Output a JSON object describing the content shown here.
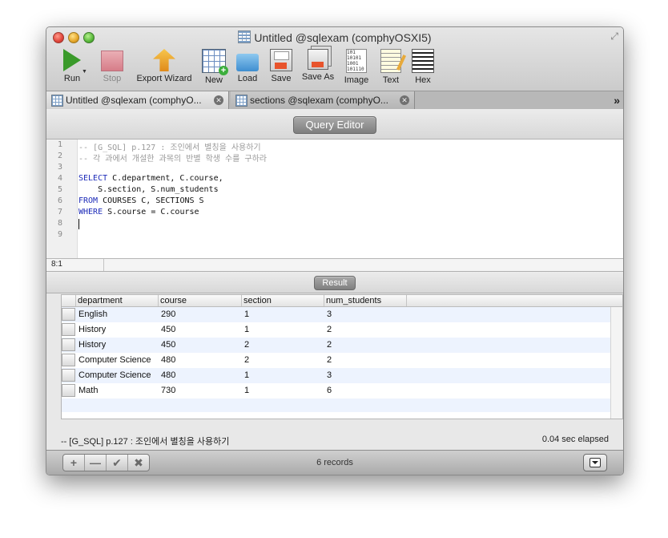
{
  "window": {
    "title": "Untitled @sqlexam (comphyOSXI5)"
  },
  "toolbar": [
    {
      "label": "Run",
      "icon": "play-icon",
      "enabled": true
    },
    {
      "label": "Stop",
      "icon": "stop-icon",
      "enabled": false
    },
    {
      "label": "Export Wizard",
      "icon": "export-wizard-icon",
      "enabled": true
    },
    {
      "label": "New",
      "icon": "new-table-icon",
      "enabled": true
    },
    {
      "label": "Load",
      "icon": "folder-icon",
      "enabled": true
    },
    {
      "label": "Save",
      "icon": "floppy-icon",
      "enabled": true
    },
    {
      "label": "Save As",
      "icon": "floppy-stack-icon",
      "enabled": true
    },
    {
      "label": "Image",
      "icon": "binary-image-icon",
      "enabled": true
    },
    {
      "label": "Text",
      "icon": "text-document-icon",
      "enabled": true
    },
    {
      "label": "Hex",
      "icon": "hex-grid-icon",
      "enabled": true
    }
  ],
  "tabs": [
    {
      "label": "Untitled @sqlexam (comphyO...",
      "active": true
    },
    {
      "label": "sections @sqlexam (comphyO...",
      "active": false
    }
  ],
  "tab_overflow": "»",
  "editor": {
    "title": "Query Editor",
    "line_numbers": [
      "1",
      "2",
      "3",
      "4",
      "5",
      "6",
      "7",
      "8",
      "9"
    ],
    "lines": {
      "l1": "-- [G_SQL] p.127 : 조인에서 별칭을 사용하기",
      "l2": "-- 각 과에서 개설한 과목의 반별 학생 수를 구하라",
      "l4_kw": "SELECT",
      "l4_rest": " C.department, C.course,",
      "l5": "    S.section, S.num_students",
      "l6_kw": "FROM",
      "l6_rest": " COURSES C, SECTIONS S",
      "l7_kw": "WHERE",
      "l7_rest": " S.course = C.course"
    },
    "cursor_position": "8:1"
  },
  "result": {
    "title": "Result",
    "columns": [
      "department",
      "course",
      "section",
      "num_students"
    ],
    "rows": [
      [
        "English",
        "290",
        "1",
        "3"
      ],
      [
        "History",
        "450",
        "1",
        "2"
      ],
      [
        "History",
        "450",
        "2",
        "2"
      ],
      [
        "Computer Science",
        "480",
        "2",
        "2"
      ],
      [
        "Computer Science",
        "480",
        "1",
        "3"
      ],
      [
        "Math",
        "730",
        "1",
        "6"
      ]
    ]
  },
  "status": {
    "query_summary": "-- [G_SQL] p.127 : 조인에서 별칭을 사용하기",
    "elapsed": "0.04 sec elapsed",
    "records": "6 records"
  },
  "footer_buttons": [
    {
      "label": "+",
      "icon": "add-icon"
    },
    {
      "label": "—",
      "icon": "remove-icon"
    },
    {
      "label": "✔",
      "icon": "check-icon"
    },
    {
      "label": "✖",
      "icon": "cancel-icon"
    }
  ],
  "colors": {
    "keyword": "#1d2bb8",
    "comment": "#9a9a9a",
    "row_alt": "#edf3fe"
  }
}
